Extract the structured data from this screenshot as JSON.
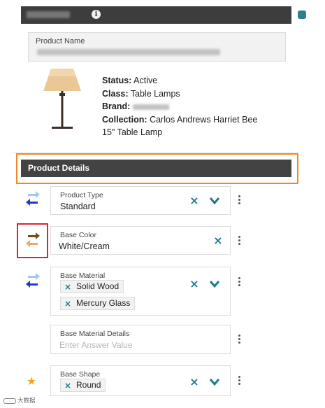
{
  "colors": {
    "accent": "#1e7a8c",
    "header_bg": "#3d3d3d",
    "section_bar": "#434343",
    "outline_orange": "#f08a24",
    "highlight_red": "#e0242a",
    "arrow_blue": "#1a3bd6",
    "arrow_light_blue": "#9ecbf0",
    "arrow_brown": "#7a4a1e",
    "arrow_orange": "#f0a86a",
    "star": "#f2a719"
  },
  "product_name": {
    "label": "Product Name"
  },
  "summary": {
    "status_label": "Status:",
    "status_value": "Active",
    "class_label": "Class:",
    "class_value": "Table Lamps",
    "brand_label": "Brand:",
    "collection_label": "Collection:",
    "collection_value": "Carlos Andrews Harriet Bee 15\" Table Lamp"
  },
  "section": {
    "title": "Product Details"
  },
  "fields": {
    "product_type": {
      "label": "Product Type",
      "value": "Standard"
    },
    "base_color": {
      "label": "Base Color",
      "value": "White/Cream"
    },
    "base_material": {
      "label": "Base Material",
      "tags": [
        "Solid Wood",
        "Mercury Glass"
      ]
    },
    "base_material_details": {
      "label": "Base Material Details",
      "placeholder": "Enter Answer Value"
    },
    "base_shape": {
      "label": "Base Shape",
      "tags": [
        "Round"
      ]
    }
  },
  "icons": {
    "remove": "×",
    "star": "★",
    "info": "i"
  },
  "watermark": {
    "text": "大数据"
  }
}
